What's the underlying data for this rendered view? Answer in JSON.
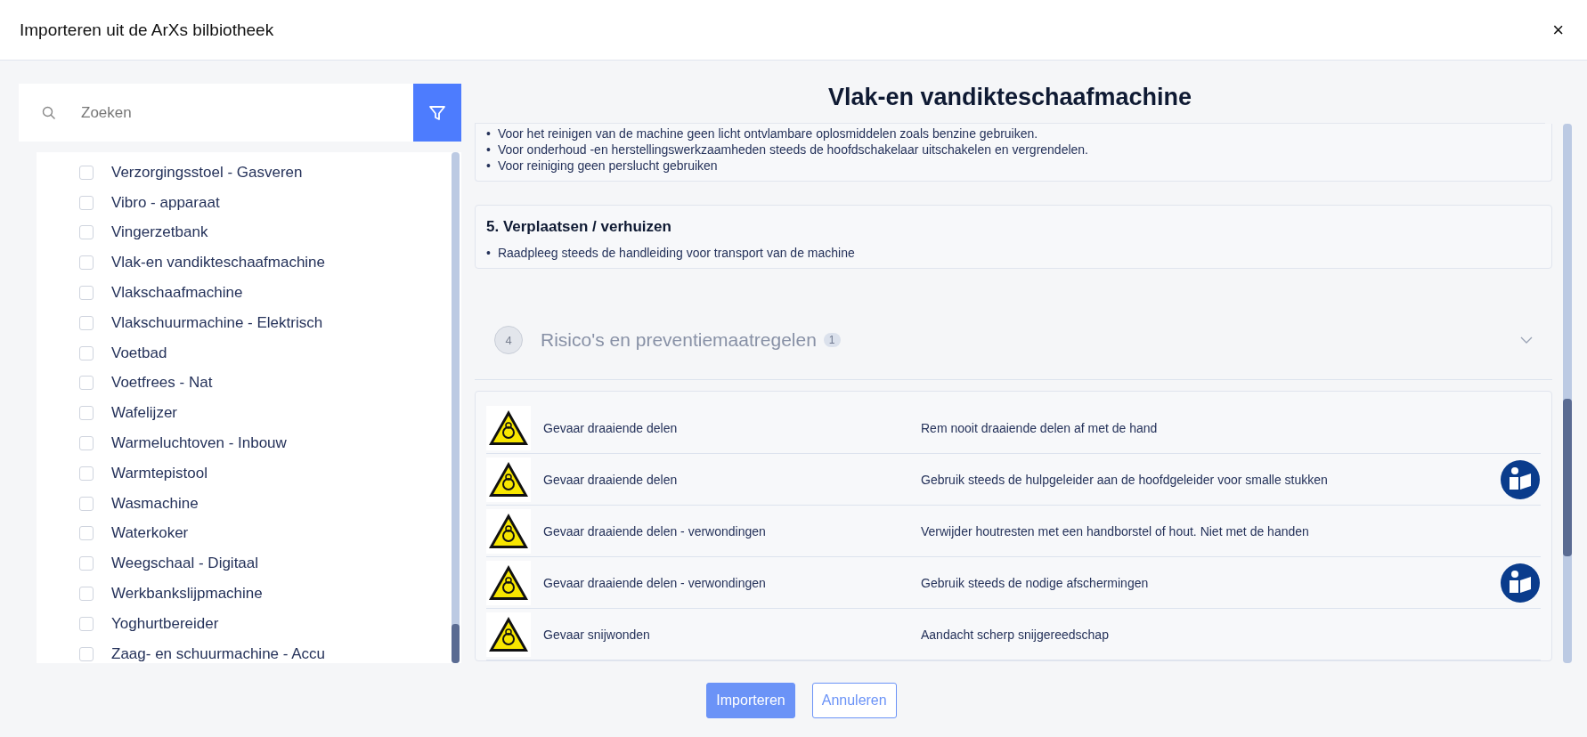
{
  "dialog": {
    "title": "Importeren uit de ArXs bilbiotheek",
    "close": "×"
  },
  "search": {
    "placeholder": "Zoeken"
  },
  "list": [
    {
      "label": "Verzorgingsstoel - Gasveren",
      "checked": false
    },
    {
      "label": "Vibro - apparaat",
      "checked": false
    },
    {
      "label": "Vingerzetbank",
      "checked": false
    },
    {
      "label": "Vlak-en vandikteschaafmachine",
      "checked": false
    },
    {
      "label": "Vlakschaafmachine",
      "checked": false
    },
    {
      "label": "Vlakschuurmachine - Elektrisch",
      "checked": false
    },
    {
      "label": "Voetbad",
      "checked": false
    },
    {
      "label": "Voetfrees - Nat",
      "checked": false
    },
    {
      "label": "Wafelijzer",
      "checked": false
    },
    {
      "label": "Warmeluchtoven - Inbouw",
      "checked": false
    },
    {
      "label": "Warmtepistool",
      "checked": false
    },
    {
      "label": "Wasmachine",
      "checked": false
    },
    {
      "label": "Waterkoker",
      "checked": false
    },
    {
      "label": "Weegschaal - Digitaal",
      "checked": false
    },
    {
      "label": "Werkbankslijpmachine",
      "checked": false
    },
    {
      "label": "Yoghurtbereider",
      "checked": false
    },
    {
      "label": "Zaag- en schuurmachine - Accu",
      "checked": false
    }
  ],
  "detail": {
    "title": "Vlak-en vandikteschaafmachine",
    "cards": [
      {
        "bullets": [
          {
            "marker": "•",
            "text": "Voor het reinigen van de machine geen licht ontvlambare oplosmiddelen zoals benzine gebruiken."
          },
          {
            "marker": "•",
            "text": "Voor onderhoud -en herstellingswerkzaamheden steeds de hoofdschakelaar uitschakelen en vergrendelen."
          },
          {
            "marker": "•",
            "text": "Voor reiniging geen perslucht gebruiken"
          }
        ]
      },
      {
        "heading": "5. Verplaatsen / verhuizen",
        "bullets": [
          {
            "marker": "•",
            "text": "Raadpleeg steeds de handleiding voor transport van de machine"
          }
        ]
      }
    ],
    "section": {
      "step": "4",
      "title": "Risico's en preventiemaatregelen",
      "count": "1",
      "expanded": false
    },
    "risks": [
      {
        "risk": "Gevaar draaiende delen",
        "measure": "Rem nooit draaiende delen af met de hand",
        "mandatory_sign": false
      },
      {
        "risk": "Gevaar draaiende delen",
        "measure": "Gebruik steeds de hulpgeleider aan de hoofdgeleider voor smalle stukken",
        "mandatory_sign": true
      },
      {
        "risk": "Gevaar draaiende delen - verwondingen",
        "measure": "Verwijder houtresten met een handborstel of hout. Niet met de handen",
        "mandatory_sign": false
      },
      {
        "risk": "Gevaar draaiende delen - verwondingen",
        "measure": "Gebruik steeds de nodige afschermingen",
        "mandatory_sign": true
      },
      {
        "risk": "Gevaar snijwonden",
        "measure": "Aandacht scherp snijgereedschap",
        "mandatory_sign": false
      }
    ]
  },
  "buttons": [
    {
      "label": "Importeren",
      "kind": "primary"
    },
    {
      "label": "Annuleren",
      "kind": "secondary"
    }
  ]
}
